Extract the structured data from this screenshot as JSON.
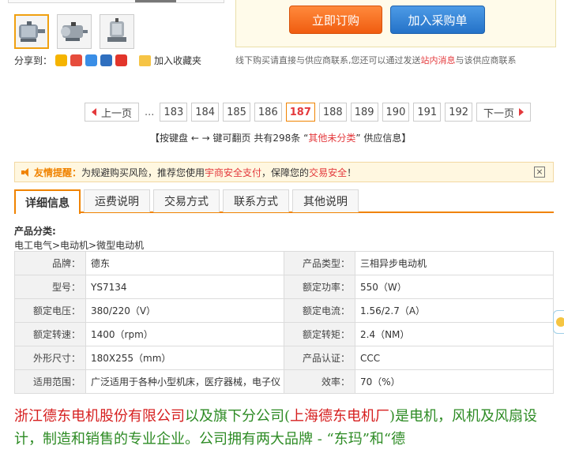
{
  "gallery": {
    "thumbs": [
      "motor-photo-1",
      "motor-photo-2",
      "motor-photo-3"
    ]
  },
  "share": {
    "label": "分享到：",
    "icons": [
      "qzone-icon",
      "weibo-icon",
      "tieba-icon",
      "renren-icon",
      "kaixin-icon"
    ],
    "favorite_label": "加入收藏夹"
  },
  "actions": {
    "buy_now": "立即订购",
    "add_to_purchase": "加入采购单"
  },
  "offline_tip": {
    "pre": "线下购买请直接与供应商联系,您还可以通过发送",
    "highlight": "站内消息",
    "post": "与该供应商联系"
  },
  "pagination": {
    "prev": "上一页",
    "next": "下一页",
    "ellipsis": "...",
    "pages": [
      "183",
      "184",
      "185",
      "186",
      "187",
      "188",
      "189",
      "190",
      "191",
      "192"
    ],
    "current": "187",
    "info_pre": "【按键盘 ← → 键可翻页  共有298条 “",
    "info_category": "其他未分类",
    "info_post": "” 供应信息】"
  },
  "notice": {
    "title": "友情提醒：",
    "text1": "为规避购买风险，推荐您使用",
    "link1": "宇商安全支付",
    "text2": "，保障您的",
    "link2": "交易安全",
    "text3": "！",
    "close": "×"
  },
  "tabs": [
    "详细信息",
    "运费说明",
    "交易方式",
    "联系方式",
    "其他说明"
  ],
  "category": {
    "label": "产品分类:",
    "path": "电工电气>电动机>微型电动机"
  },
  "specs": [
    {
      "k1": "品牌：",
      "v1": "德东",
      "k2": "产品类型：",
      "v2": "三相异步电动机"
    },
    {
      "k1": "型号：",
      "v1": "YS7134",
      "k2": "额定功率：",
      "v2": "550（W）"
    },
    {
      "k1": "额定电压：",
      "v1": "380/220（V）",
      "k2": "额定电流：",
      "v2": "1.56/2.7（A）"
    },
    {
      "k1": "额定转速：",
      "v1": "1400（rpm）",
      "k2": "额定转矩：",
      "v2": "2.4（NM）"
    },
    {
      "k1": "外形尺寸：",
      "v1": "180X255（mm）",
      "k2": "产品认证：",
      "v2": "CCC"
    },
    {
      "k1": "适用范围：",
      "v1": "广泛适用于各种小型机床，医疗器械，电子仪",
      "k2": "效率：",
      "v2": "70（%）"
    }
  ],
  "description": {
    "company": "浙江德东电机股份有限公司",
    "t1": "以及旗下分公司(",
    "sub": "上海德东电机厂",
    "t2": ")是电机，风机及风扇设计，制造和销售的专业企业。公司拥有两大品牌 - “东玛”和“德"
  },
  "colors": {
    "accent": "#f08300",
    "buy_button": "#f05c10",
    "cart_button": "#2472c8",
    "highlight_red": "#e4393c",
    "desc_green": "#2d8b24"
  }
}
